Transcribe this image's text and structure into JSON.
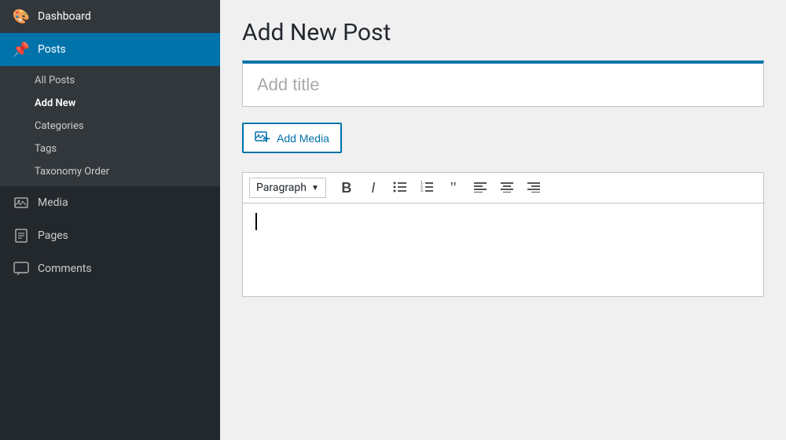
{
  "sidebar": {
    "items": [
      {
        "id": "dashboard",
        "label": "Dashboard",
        "icon": "🎨",
        "active": false
      },
      {
        "id": "posts",
        "label": "Posts",
        "icon": "📌",
        "active": true
      }
    ],
    "posts_submenu": [
      {
        "id": "all-posts",
        "label": "All Posts",
        "active": false
      },
      {
        "id": "add-new",
        "label": "Add New",
        "active": true
      },
      {
        "id": "categories",
        "label": "Categories",
        "active": false
      },
      {
        "id": "tags",
        "label": "Tags",
        "active": false
      },
      {
        "id": "taxonomy-order",
        "label": "Taxonomy Order",
        "active": false
      }
    ],
    "bottom_items": [
      {
        "id": "media",
        "label": "Media",
        "icon": "🖼",
        "active": false
      },
      {
        "id": "pages",
        "label": "Pages",
        "icon": "📄",
        "active": false
      },
      {
        "id": "comments",
        "label": "Comments",
        "icon": "💬",
        "active": false
      }
    ]
  },
  "main": {
    "page_title": "Add New Post",
    "title_placeholder": "Add title",
    "add_media_label": "Add Media",
    "toolbar": {
      "paragraph_label": "Paragraph",
      "bold_label": "B",
      "italic_label": "I",
      "ul_label": "≡",
      "ol_label": "≡",
      "quote_label": "❝",
      "align_left_label": "≡",
      "align_center_label": "≡",
      "align_right_label": "≡"
    }
  }
}
